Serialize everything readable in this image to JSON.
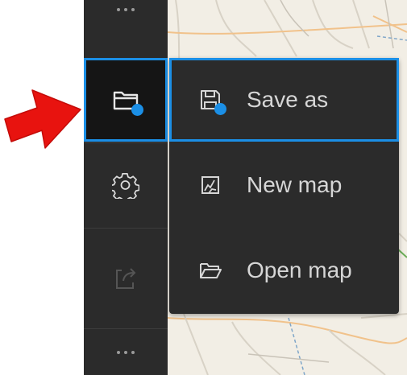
{
  "toolbar": {
    "more_top_icon": "more-dots-icon",
    "active_icon": "folder-icon",
    "settings_icon": "gear-icon",
    "share_icon": "share-export-icon",
    "more_bottom_icon": "more-dots-icon",
    "accent_color": "#1b8fe6"
  },
  "menu": {
    "items": [
      {
        "label": "Save as",
        "icon": "save-icon",
        "selected": true
      },
      {
        "label": "New map",
        "icon": "new-map-icon",
        "selected": false
      },
      {
        "label": "Open map",
        "icon": "open-folder-icon",
        "selected": false
      }
    ]
  },
  "annotation": {
    "arrow_color": "#e8130f",
    "arrow_icon": "red-arrow-icon"
  }
}
